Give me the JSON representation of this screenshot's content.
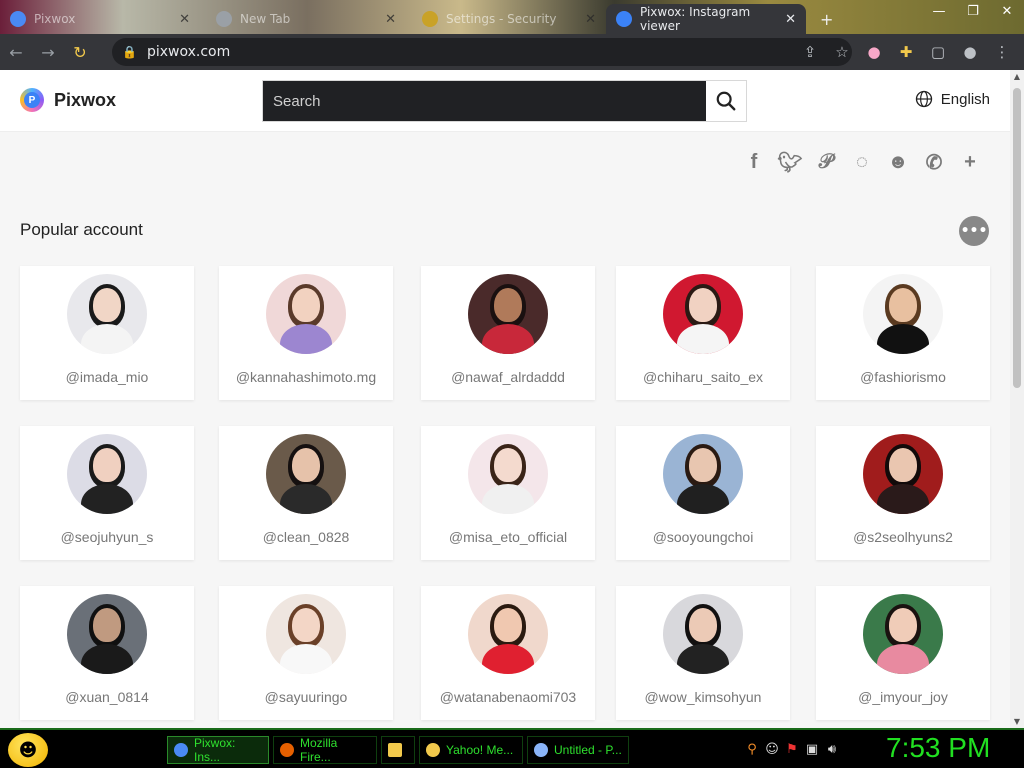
{
  "browser": {
    "tabs": [
      {
        "label": "Pixwox",
        "active": false
      },
      {
        "label": "New Tab",
        "active": false
      },
      {
        "label": "Settings - Security",
        "active": false
      },
      {
        "label": "Pixwox: Instagram viewer",
        "active": true
      }
    ],
    "url": "pixwox.com"
  },
  "site": {
    "logo_text": "Pixwox",
    "search_placeholder": "Search",
    "language": "English"
  },
  "share_icons": [
    "facebook-icon",
    "twitter-icon",
    "pinterest-icon",
    "whatsapp-icon",
    "reddit-icon",
    "messenger-icon",
    "plus-icon"
  ],
  "section": {
    "title": "Popular account",
    "more_label": "•••"
  },
  "accounts": [
    {
      "handle": "@imada_mio",
      "bg": "#e8e8ec",
      "skin": "#f1d6c6",
      "cloth": "#f4f4f4",
      "hair": "#1a1a1a"
    },
    {
      "handle": "@kannahashimoto.mg",
      "bg": "#f0d8d8",
      "skin": "#f2d2c0",
      "cloth": "#9c86d0",
      "hair": "#5a3a2a"
    },
    {
      "handle": "@nawaf_alrdaddd",
      "bg": "#4a2a2a",
      "skin": "#b07a5a",
      "cloth": "#c8283a",
      "hair": "#1a1010"
    },
    {
      "handle": "@chiharu_saito_ex",
      "bg": "#d01830",
      "skin": "#f1d2c2",
      "cloth": "#f5f5f5",
      "hair": "#2a1a14"
    },
    {
      "handle": "@fashiorismo",
      "bg": "#f4f4f4",
      "skin": "#e8c0a0",
      "cloth": "#111111",
      "hair": "#5a3a20"
    },
    {
      "handle": "@seojuhyun_s",
      "bg": "#dcdce6",
      "skin": "#f0d0c0",
      "cloth": "#222222",
      "hair": "#1a1a1a"
    },
    {
      "handle": "@clean_0828",
      "bg": "#6a5a4a",
      "skin": "#e6c2aa",
      "cloth": "#2a2a2a",
      "hair": "#151010"
    },
    {
      "handle": "@misa_eto_official",
      "bg": "#f4e6ea",
      "skin": "#f4dace",
      "cloth": "#f0f0f0",
      "hair": "#3a2418"
    },
    {
      "handle": "@sooyoungchoi",
      "bg": "#9ab4d4",
      "skin": "#e8c6b0",
      "cloth": "#202020",
      "hair": "#2a1a12"
    },
    {
      "handle": "@s2seolhyuns2",
      "bg": "#a01c1c",
      "skin": "#eac6b0",
      "cloth": "#2a1a1a",
      "hair": "#120a0a"
    },
    {
      "handle": "@xuan_0814",
      "bg": "#6a7078",
      "skin": "#c09a80",
      "cloth": "#1a1a1a",
      "hair": "#101010"
    },
    {
      "handle": "@sayuuringo",
      "bg": "#efe6e0",
      "skin": "#f3d6c6",
      "cloth": "#f8f8f8",
      "hair": "#6a4028"
    },
    {
      "handle": "@watanabenaomi703",
      "bg": "#f0d8cc",
      "skin": "#f0c8b0",
      "cloth": "#e02030",
      "hair": "#2a1a10"
    },
    {
      "handle": "@wow_kimsohyun",
      "bg": "#d8d8dc",
      "skin": "#eccab6",
      "cloth": "#222222",
      "hair": "#121010"
    },
    {
      "handle": "@_imyour_joy",
      "bg": "#3a7a4a",
      "skin": "#f0ccb8",
      "cloth": "#e88aa0",
      "hair": "#1a1210"
    }
  ],
  "taskbar": {
    "tasks": [
      {
        "label": "Pixwox: Ins...",
        "active": true
      },
      {
        "label": "Mozilla Fire...",
        "active": false
      },
      {
        "label": "",
        "active": false
      },
      {
        "label": "Yahoo! Me...",
        "active": false
      },
      {
        "label": "Untitled - P...",
        "active": false
      }
    ],
    "clock": "7:53 PM"
  }
}
